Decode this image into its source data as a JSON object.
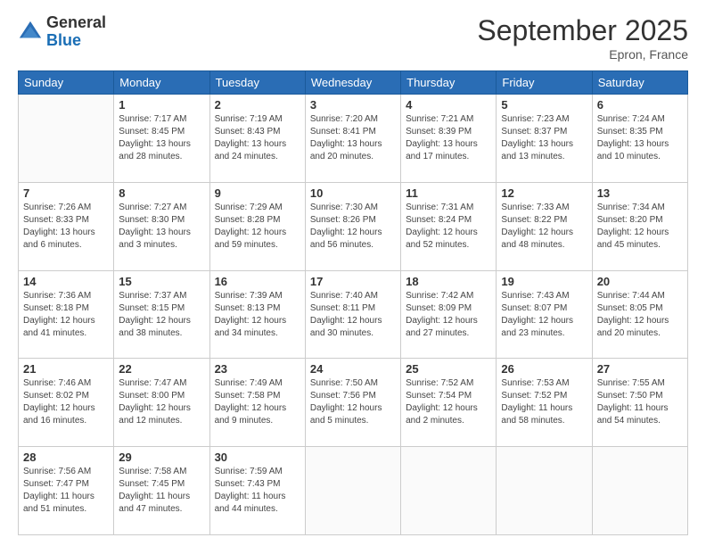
{
  "logo": {
    "general": "General",
    "blue": "Blue"
  },
  "header": {
    "month": "September 2025",
    "location": "Epron, France"
  },
  "days_of_week": [
    "Sunday",
    "Monday",
    "Tuesday",
    "Wednesday",
    "Thursday",
    "Friday",
    "Saturday"
  ],
  "weeks": [
    [
      {
        "day": "",
        "info": ""
      },
      {
        "day": "1",
        "info": "Sunrise: 7:17 AM\nSunset: 8:45 PM\nDaylight: 13 hours\nand 28 minutes."
      },
      {
        "day": "2",
        "info": "Sunrise: 7:19 AM\nSunset: 8:43 PM\nDaylight: 13 hours\nand 24 minutes."
      },
      {
        "day": "3",
        "info": "Sunrise: 7:20 AM\nSunset: 8:41 PM\nDaylight: 13 hours\nand 20 minutes."
      },
      {
        "day": "4",
        "info": "Sunrise: 7:21 AM\nSunset: 8:39 PM\nDaylight: 13 hours\nand 17 minutes."
      },
      {
        "day": "5",
        "info": "Sunrise: 7:23 AM\nSunset: 8:37 PM\nDaylight: 13 hours\nand 13 minutes."
      },
      {
        "day": "6",
        "info": "Sunrise: 7:24 AM\nSunset: 8:35 PM\nDaylight: 13 hours\nand 10 minutes."
      }
    ],
    [
      {
        "day": "7",
        "info": "Sunrise: 7:26 AM\nSunset: 8:33 PM\nDaylight: 13 hours\nand 6 minutes."
      },
      {
        "day": "8",
        "info": "Sunrise: 7:27 AM\nSunset: 8:30 PM\nDaylight: 13 hours\nand 3 minutes."
      },
      {
        "day": "9",
        "info": "Sunrise: 7:29 AM\nSunset: 8:28 PM\nDaylight: 12 hours\nand 59 minutes."
      },
      {
        "day": "10",
        "info": "Sunrise: 7:30 AM\nSunset: 8:26 PM\nDaylight: 12 hours\nand 56 minutes."
      },
      {
        "day": "11",
        "info": "Sunrise: 7:31 AM\nSunset: 8:24 PM\nDaylight: 12 hours\nand 52 minutes."
      },
      {
        "day": "12",
        "info": "Sunrise: 7:33 AM\nSunset: 8:22 PM\nDaylight: 12 hours\nand 48 minutes."
      },
      {
        "day": "13",
        "info": "Sunrise: 7:34 AM\nSunset: 8:20 PM\nDaylight: 12 hours\nand 45 minutes."
      }
    ],
    [
      {
        "day": "14",
        "info": "Sunrise: 7:36 AM\nSunset: 8:18 PM\nDaylight: 12 hours\nand 41 minutes."
      },
      {
        "day": "15",
        "info": "Sunrise: 7:37 AM\nSunset: 8:15 PM\nDaylight: 12 hours\nand 38 minutes."
      },
      {
        "day": "16",
        "info": "Sunrise: 7:39 AM\nSunset: 8:13 PM\nDaylight: 12 hours\nand 34 minutes."
      },
      {
        "day": "17",
        "info": "Sunrise: 7:40 AM\nSunset: 8:11 PM\nDaylight: 12 hours\nand 30 minutes."
      },
      {
        "day": "18",
        "info": "Sunrise: 7:42 AM\nSunset: 8:09 PM\nDaylight: 12 hours\nand 27 minutes."
      },
      {
        "day": "19",
        "info": "Sunrise: 7:43 AM\nSunset: 8:07 PM\nDaylight: 12 hours\nand 23 minutes."
      },
      {
        "day": "20",
        "info": "Sunrise: 7:44 AM\nSunset: 8:05 PM\nDaylight: 12 hours\nand 20 minutes."
      }
    ],
    [
      {
        "day": "21",
        "info": "Sunrise: 7:46 AM\nSunset: 8:02 PM\nDaylight: 12 hours\nand 16 minutes."
      },
      {
        "day": "22",
        "info": "Sunrise: 7:47 AM\nSunset: 8:00 PM\nDaylight: 12 hours\nand 12 minutes."
      },
      {
        "day": "23",
        "info": "Sunrise: 7:49 AM\nSunset: 7:58 PM\nDaylight: 12 hours\nand 9 minutes."
      },
      {
        "day": "24",
        "info": "Sunrise: 7:50 AM\nSunset: 7:56 PM\nDaylight: 12 hours\nand 5 minutes."
      },
      {
        "day": "25",
        "info": "Sunrise: 7:52 AM\nSunset: 7:54 PM\nDaylight: 12 hours\nand 2 minutes."
      },
      {
        "day": "26",
        "info": "Sunrise: 7:53 AM\nSunset: 7:52 PM\nDaylight: 11 hours\nand 58 minutes."
      },
      {
        "day": "27",
        "info": "Sunrise: 7:55 AM\nSunset: 7:50 PM\nDaylight: 11 hours\nand 54 minutes."
      }
    ],
    [
      {
        "day": "28",
        "info": "Sunrise: 7:56 AM\nSunset: 7:47 PM\nDaylight: 11 hours\nand 51 minutes."
      },
      {
        "day": "29",
        "info": "Sunrise: 7:58 AM\nSunset: 7:45 PM\nDaylight: 11 hours\nand 47 minutes."
      },
      {
        "day": "30",
        "info": "Sunrise: 7:59 AM\nSunset: 7:43 PM\nDaylight: 11 hours\nand 44 minutes."
      },
      {
        "day": "",
        "info": ""
      },
      {
        "day": "",
        "info": ""
      },
      {
        "day": "",
        "info": ""
      },
      {
        "day": "",
        "info": ""
      }
    ]
  ]
}
